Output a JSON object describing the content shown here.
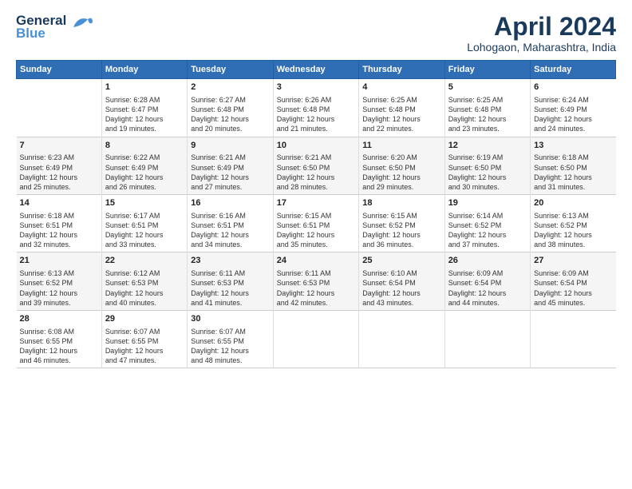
{
  "header": {
    "logo_line1": "General",
    "logo_line2": "Blue",
    "title": "April 2024",
    "subtitle": "Lohogaon, Maharashtra, India"
  },
  "days_header": [
    "Sunday",
    "Monday",
    "Tuesday",
    "Wednesday",
    "Thursday",
    "Friday",
    "Saturday"
  ],
  "weeks": [
    [
      {
        "num": "",
        "text": ""
      },
      {
        "num": "1",
        "text": "Sunrise: 6:28 AM\nSunset: 6:47 PM\nDaylight: 12 hours\nand 19 minutes."
      },
      {
        "num": "2",
        "text": "Sunrise: 6:27 AM\nSunset: 6:48 PM\nDaylight: 12 hours\nand 20 minutes."
      },
      {
        "num": "3",
        "text": "Sunrise: 6:26 AM\nSunset: 6:48 PM\nDaylight: 12 hours\nand 21 minutes."
      },
      {
        "num": "4",
        "text": "Sunrise: 6:25 AM\nSunset: 6:48 PM\nDaylight: 12 hours\nand 22 minutes."
      },
      {
        "num": "5",
        "text": "Sunrise: 6:25 AM\nSunset: 6:48 PM\nDaylight: 12 hours\nand 23 minutes."
      },
      {
        "num": "6",
        "text": "Sunrise: 6:24 AM\nSunset: 6:49 PM\nDaylight: 12 hours\nand 24 minutes."
      }
    ],
    [
      {
        "num": "7",
        "text": "Sunrise: 6:23 AM\nSunset: 6:49 PM\nDaylight: 12 hours\nand 25 minutes."
      },
      {
        "num": "8",
        "text": "Sunrise: 6:22 AM\nSunset: 6:49 PM\nDaylight: 12 hours\nand 26 minutes."
      },
      {
        "num": "9",
        "text": "Sunrise: 6:21 AM\nSunset: 6:49 PM\nDaylight: 12 hours\nand 27 minutes."
      },
      {
        "num": "10",
        "text": "Sunrise: 6:21 AM\nSunset: 6:50 PM\nDaylight: 12 hours\nand 28 minutes."
      },
      {
        "num": "11",
        "text": "Sunrise: 6:20 AM\nSunset: 6:50 PM\nDaylight: 12 hours\nand 29 minutes."
      },
      {
        "num": "12",
        "text": "Sunrise: 6:19 AM\nSunset: 6:50 PM\nDaylight: 12 hours\nand 30 minutes."
      },
      {
        "num": "13",
        "text": "Sunrise: 6:18 AM\nSunset: 6:50 PM\nDaylight: 12 hours\nand 31 minutes."
      }
    ],
    [
      {
        "num": "14",
        "text": "Sunrise: 6:18 AM\nSunset: 6:51 PM\nDaylight: 12 hours\nand 32 minutes."
      },
      {
        "num": "15",
        "text": "Sunrise: 6:17 AM\nSunset: 6:51 PM\nDaylight: 12 hours\nand 33 minutes."
      },
      {
        "num": "16",
        "text": "Sunrise: 6:16 AM\nSunset: 6:51 PM\nDaylight: 12 hours\nand 34 minutes."
      },
      {
        "num": "17",
        "text": "Sunrise: 6:15 AM\nSunset: 6:51 PM\nDaylight: 12 hours\nand 35 minutes."
      },
      {
        "num": "18",
        "text": "Sunrise: 6:15 AM\nSunset: 6:52 PM\nDaylight: 12 hours\nand 36 minutes."
      },
      {
        "num": "19",
        "text": "Sunrise: 6:14 AM\nSunset: 6:52 PM\nDaylight: 12 hours\nand 37 minutes."
      },
      {
        "num": "20",
        "text": "Sunrise: 6:13 AM\nSunset: 6:52 PM\nDaylight: 12 hours\nand 38 minutes."
      }
    ],
    [
      {
        "num": "21",
        "text": "Sunrise: 6:13 AM\nSunset: 6:52 PM\nDaylight: 12 hours\nand 39 minutes."
      },
      {
        "num": "22",
        "text": "Sunrise: 6:12 AM\nSunset: 6:53 PM\nDaylight: 12 hours\nand 40 minutes."
      },
      {
        "num": "23",
        "text": "Sunrise: 6:11 AM\nSunset: 6:53 PM\nDaylight: 12 hours\nand 41 minutes."
      },
      {
        "num": "24",
        "text": "Sunrise: 6:11 AM\nSunset: 6:53 PM\nDaylight: 12 hours\nand 42 minutes."
      },
      {
        "num": "25",
        "text": "Sunrise: 6:10 AM\nSunset: 6:54 PM\nDaylight: 12 hours\nand 43 minutes."
      },
      {
        "num": "26",
        "text": "Sunrise: 6:09 AM\nSunset: 6:54 PM\nDaylight: 12 hours\nand 44 minutes."
      },
      {
        "num": "27",
        "text": "Sunrise: 6:09 AM\nSunset: 6:54 PM\nDaylight: 12 hours\nand 45 minutes."
      }
    ],
    [
      {
        "num": "28",
        "text": "Sunrise: 6:08 AM\nSunset: 6:55 PM\nDaylight: 12 hours\nand 46 minutes."
      },
      {
        "num": "29",
        "text": "Sunrise: 6:07 AM\nSunset: 6:55 PM\nDaylight: 12 hours\nand 47 minutes."
      },
      {
        "num": "30",
        "text": "Sunrise: 6:07 AM\nSunset: 6:55 PM\nDaylight: 12 hours\nand 48 minutes."
      },
      {
        "num": "",
        "text": ""
      },
      {
        "num": "",
        "text": ""
      },
      {
        "num": "",
        "text": ""
      },
      {
        "num": "",
        "text": ""
      }
    ]
  ]
}
